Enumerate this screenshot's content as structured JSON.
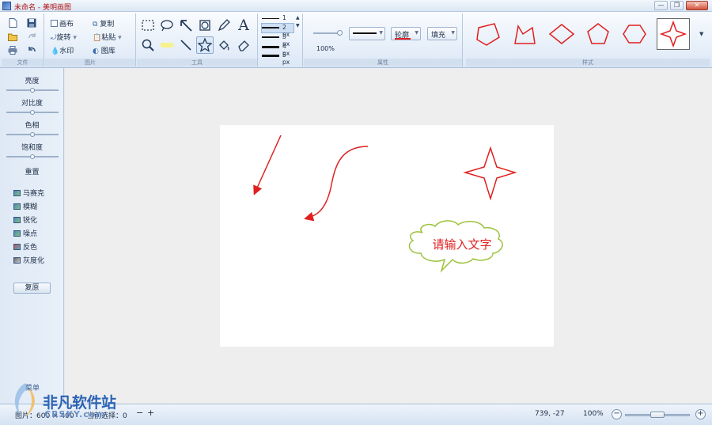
{
  "window": {
    "title": "未命名 - 美明画图",
    "controls": {
      "minimize": "—",
      "restore": "❐",
      "close": "✕"
    }
  },
  "ribbon": {
    "groups": {
      "file": "文件",
      "image": "图片",
      "tools": "工具",
      "properties": "属性",
      "styles": "样式"
    },
    "image_group": {
      "canvas": "画布",
      "rotate": "旋转",
      "watermark": "水印",
      "copy": "复制",
      "paste": "粘贴",
      "gallery": "图库"
    },
    "line_widths": [
      "1 px",
      "2 px",
      "3 px",
      "4 px",
      "5 px"
    ],
    "selected_line_width": "2 px",
    "opacity_label": "100%",
    "outline_label": "轮廓",
    "fill_label": "填充",
    "outline_color": "#e02020",
    "shape_stroke_color": "#e02020"
  },
  "left_panel": {
    "adjustments": [
      {
        "label": "亮度",
        "level": 0.5
      },
      {
        "label": "对比度",
        "level": 0.5
      },
      {
        "label": "色相",
        "level": 0.5
      },
      {
        "label": "饱和度",
        "level": 0.5
      }
    ],
    "effects_title": "重置",
    "effects": [
      "马赛克",
      "模糊",
      "锐化",
      "噪点",
      "反色",
      "灰度化"
    ],
    "restore_label": "复原"
  },
  "canvas": {
    "callout_text": "请输入文字",
    "callout_text_color": "#e02020",
    "callout_border_color": "#9cc23a",
    "arrow_color": "#e02020",
    "star_color": "#e02020"
  },
  "statusbar": {
    "image_size": "图片：600 × 400",
    "selection": "当前选择：0",
    "zoom_out_small": "−",
    "zoom_in_small": "+",
    "coords": "739, -27",
    "zoom": "100%",
    "zoom_minus": "−",
    "zoom_plus": "+",
    "zoom_level": 0.5
  },
  "watermark": {
    "menu_label": "菜单",
    "brand": "非凡软件站",
    "domain": "CRSKY.com"
  }
}
